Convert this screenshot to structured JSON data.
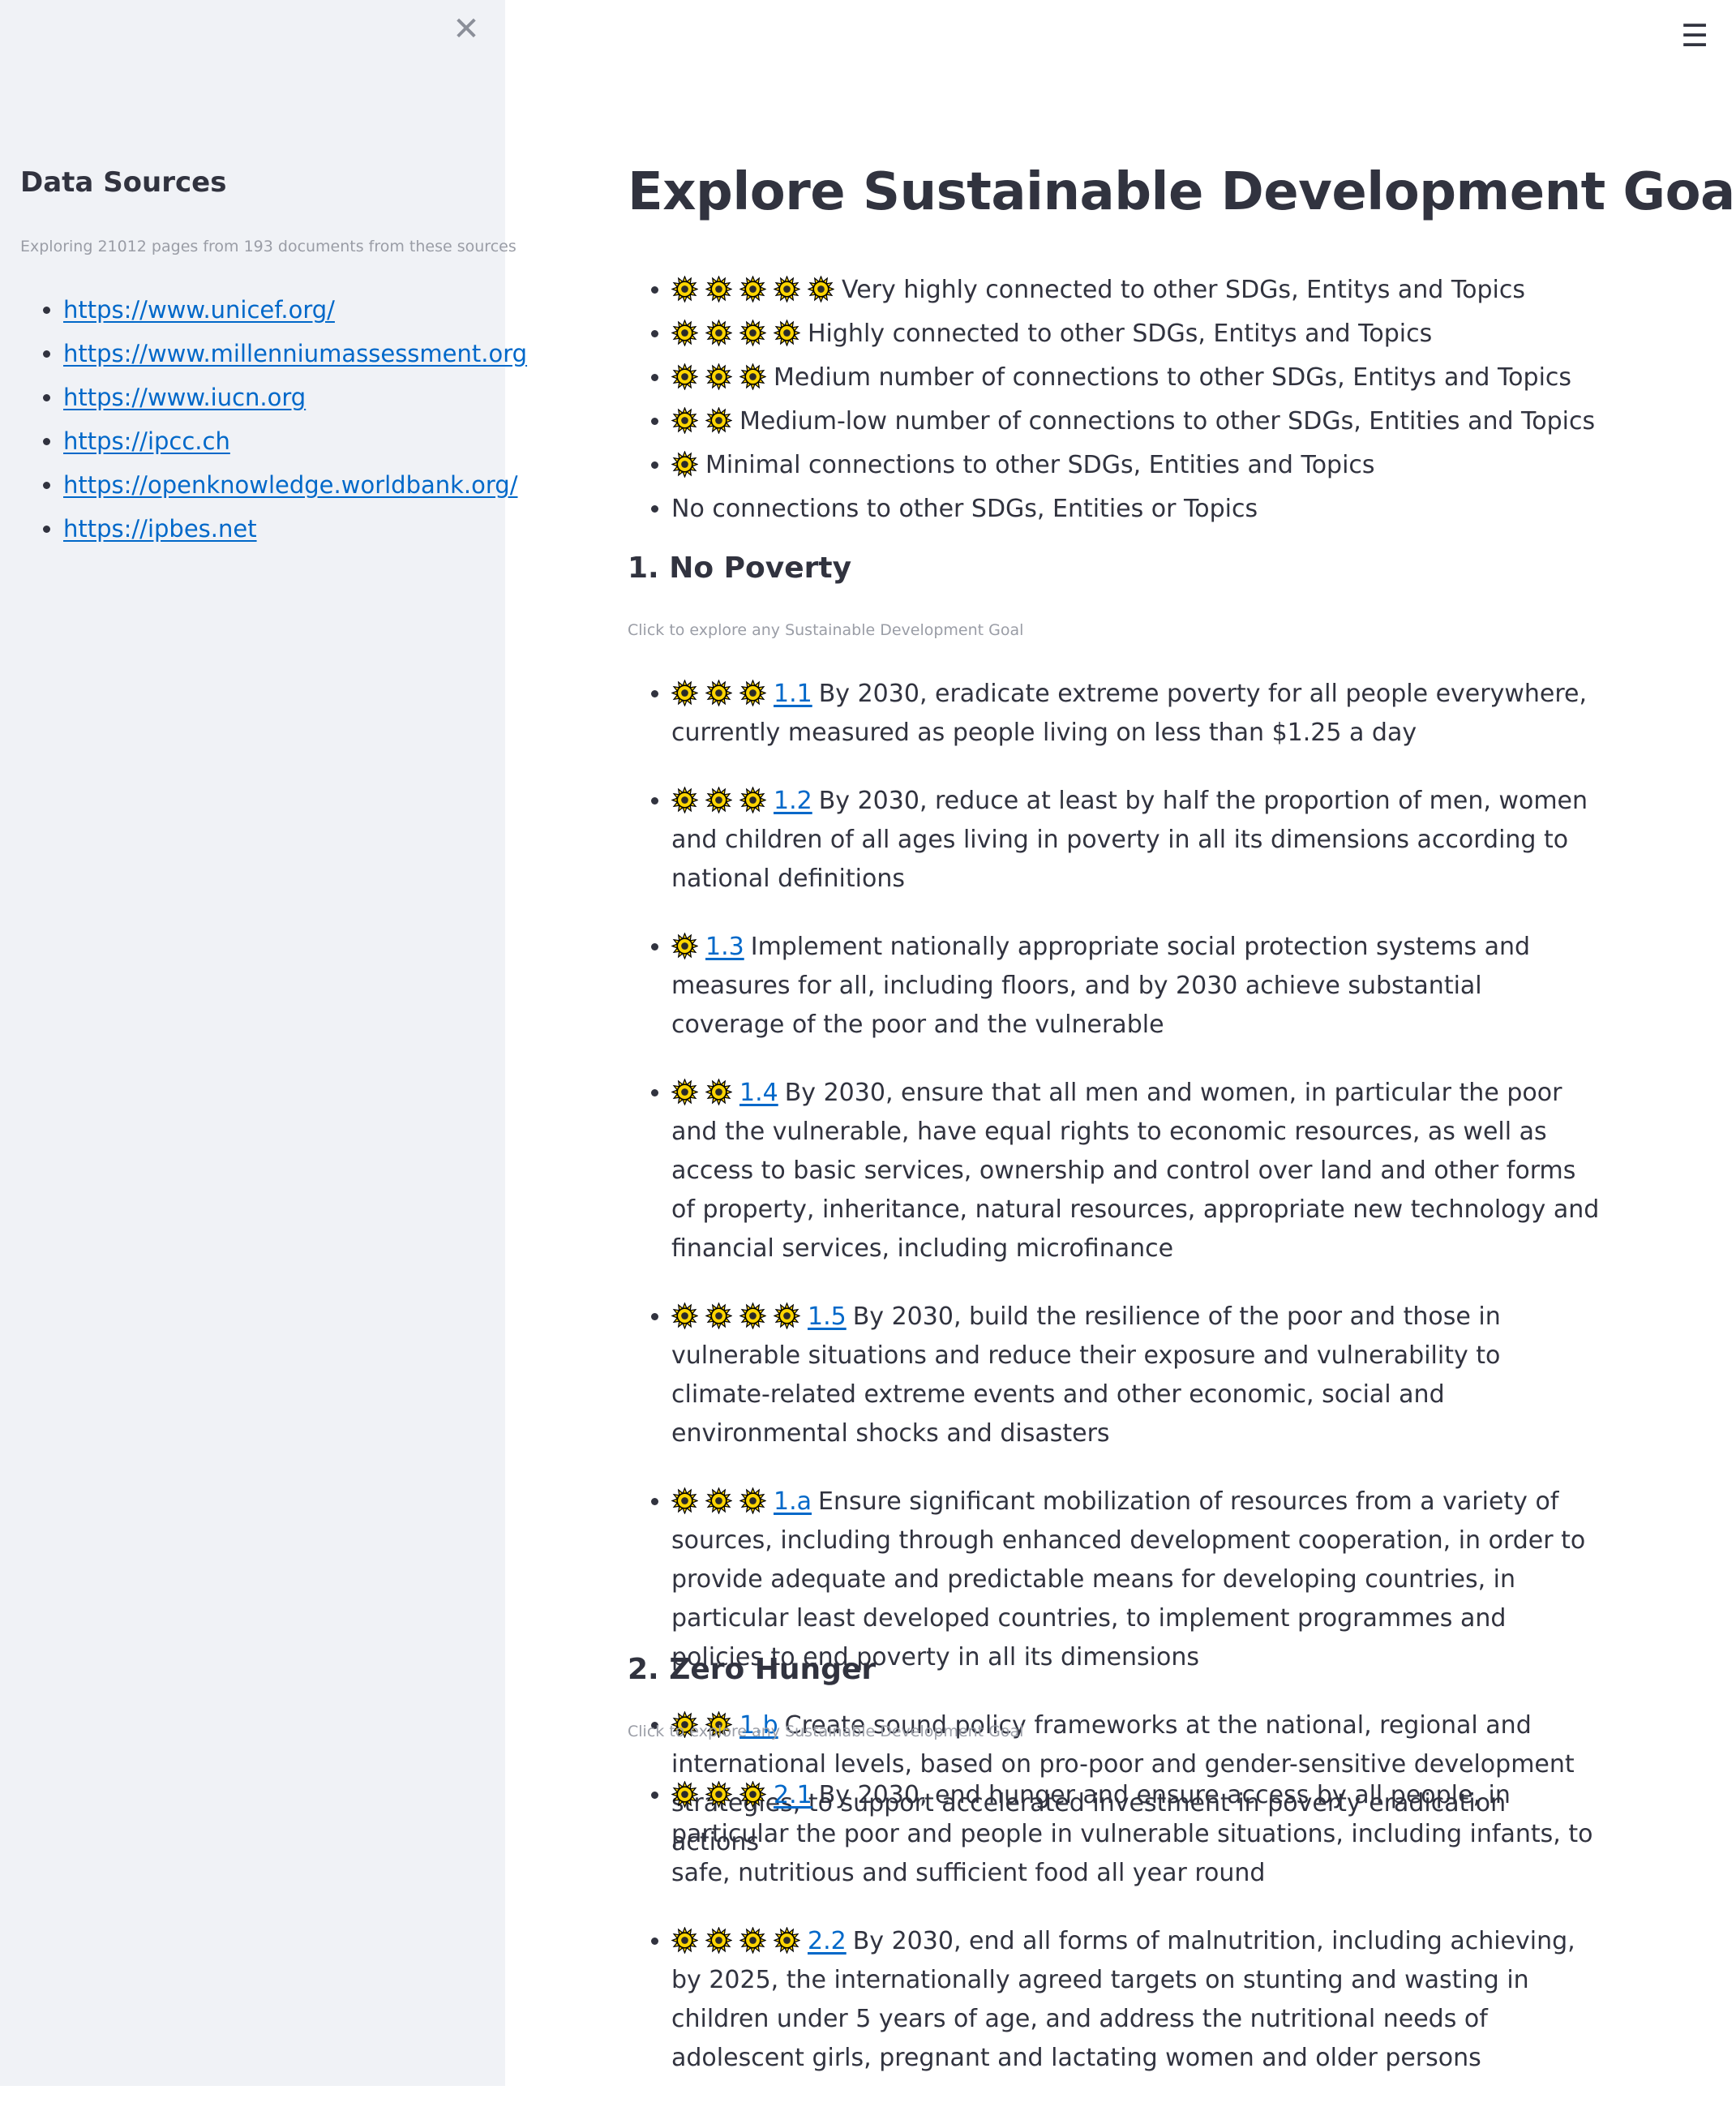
{
  "sidebar": {
    "close_icon": "close-icon",
    "title": "Data Sources",
    "caption": "Exploring 21012 pages from 193 documents from these sources",
    "links": [
      "https://www.unicef.org/",
      "https://www.millenniumassessment.org",
      "https://www.iucn.org",
      "https://ipcc.ch",
      "https://openknowledge.worldbank.org/",
      "https://ipbes.net"
    ]
  },
  "header": {
    "menu_icon": "hamburger-menu-icon"
  },
  "main": {
    "title": "Explore Sustainable Development Goals",
    "legend": [
      {
        "suns": 5,
        "text": "Very highly connected to other SDGs, Entitys and Topics"
      },
      {
        "suns": 4,
        "text": "Highly connected to other SDGs, Entitys and Topics"
      },
      {
        "suns": 3,
        "text": "Medium number of connections to other SDGs, Entitys and Topics"
      },
      {
        "suns": 2,
        "text": "Medium-low number of connections to other SDGs, Entities and Topics"
      },
      {
        "suns": 1,
        "text": "Minimal connections to other SDGs, Entities and Topics"
      },
      {
        "suns": 0,
        "text": "No connections to other SDGs, Entities or Topics"
      }
    ],
    "goals": [
      {
        "title": "1. No Poverty",
        "caption": "Click to explore any Sustainable Development Goal",
        "targets": [
          {
            "suns": 3,
            "id": "1.1",
            "text": "By 2030, eradicate extreme poverty for all people everywhere, currently measured as people living on less than $1.25 a day"
          },
          {
            "suns": 3,
            "id": "1.2",
            "text": "By 2030, reduce at least by half the proportion of men, women and children of all ages living in poverty in all its dimensions according to national definitions"
          },
          {
            "suns": 1,
            "id": "1.3",
            "text": "Implement nationally appropriate social protection systems and measures for all, including floors, and by 2030 achieve substantial coverage of the poor and the vulnerable"
          },
          {
            "suns": 2,
            "id": "1.4",
            "text": "By 2030, ensure that all men and women, in particular the poor and the vulnerable, have equal rights to economic resources, as well as access to basic services, ownership and control over land and other forms of property, inheritance, natural resources, appropriate new technology and financial services, including microfinance"
          },
          {
            "suns": 4,
            "id": "1.5",
            "text": "By 2030, build the resilience of the poor and those in vulnerable situations and reduce their exposure and vulnerability to climate-related extreme events and other economic, social and environmental shocks and disasters"
          },
          {
            "suns": 3,
            "id": "1.a",
            "text": "Ensure significant mobilization of resources from a variety of sources, including through enhanced development cooperation, in order to provide adequate and predictable means for developing countries, in particular least developed countries, to implement programmes and policies to end poverty in all its dimensions"
          },
          {
            "suns": 2,
            "id": "1.b",
            "text": "Create sound policy frameworks at the national, regional and international levels, based on pro-poor and gender-sensitive development strategies, to support accelerated investment in poverty eradication actions"
          }
        ]
      },
      {
        "title": "2. Zero Hunger",
        "caption": "Click to explore any Sustainable Development Goal",
        "targets": [
          {
            "suns": 3,
            "id": "2.1",
            "text": "By 2030, end hunger and ensure access by all people, in particular the poor and people in vulnerable situations, including infants, to safe, nutritious and sufficient food all year round"
          },
          {
            "suns": 4,
            "id": "2.2",
            "text": "By 2030, end all forms of malnutrition, including achieving, by 2025, the internationally agreed targets on stunting and wasting in children under 5 years of age, and address the nutritional needs of adolescent girls, pregnant and lactating women and older persons"
          }
        ]
      }
    ]
  },
  "colors": {
    "sidebar_bg": "#f0f2f6",
    "link": "#0068c9",
    "text": "#31333f",
    "caption": "#9a9da6",
    "sun_fill": "#ffd500"
  }
}
